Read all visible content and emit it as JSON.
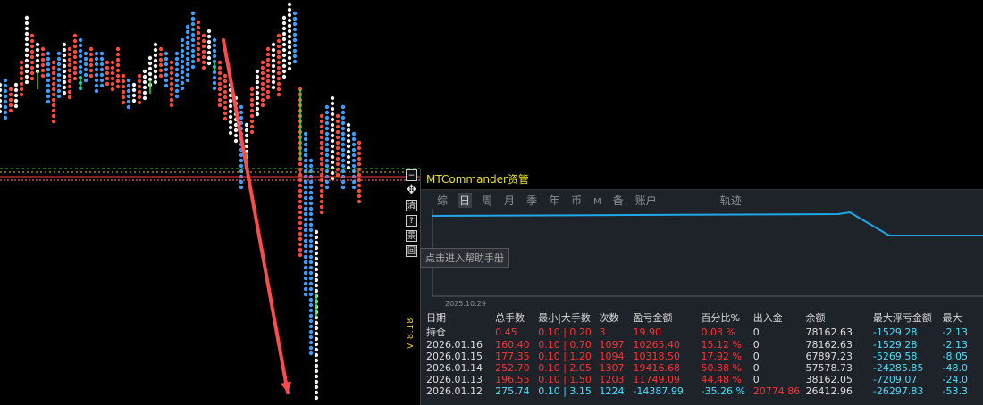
{
  "panel": {
    "title": "MTCommander资管",
    "version": "V 8.18",
    "help_tooltip": "点击进入帮助手册",
    "side_tools": [
      "清",
      "?",
      "景",
      "回"
    ],
    "tabs": [
      "综",
      "日",
      "周",
      "月",
      "季",
      "年",
      "币",
      "M",
      "备",
      "账户",
      "轨迹"
    ],
    "active_tab": "日",
    "curve_date": "2025.10.29",
    "columns": [
      "日期",
      "总手数",
      "最小|大手数",
      "次数",
      "盈亏金额",
      "百分比%",
      "出入金",
      "余额",
      "最大浮亏金额",
      "最大"
    ],
    "rows": [
      {
        "date": "持仓",
        "lots": "0.45",
        "minmax": "0.10 | 0.20",
        "count": "3",
        "pl": "19.90",
        "pct": "0.03 %",
        "io": "0",
        "balance": "78162.63",
        "float": "-1529.28",
        "last": "-2.13",
        "color": "red"
      },
      {
        "date": "2026.01.16",
        "lots": "160.40",
        "minmax": "0.10 | 0.70",
        "count": "1097",
        "pl": "10265.40",
        "pct": "15.12 %",
        "io": "0",
        "balance": "78162.63",
        "float": "-1529.28",
        "last": "-2.13",
        "color": "red"
      },
      {
        "date": "2026.01.15",
        "lots": "177.35",
        "minmax": "0.10 | 1.20",
        "count": "1094",
        "pl": "10318.50",
        "pct": "17.92 %",
        "io": "0",
        "balance": "67897.23",
        "float": "-5269.58",
        "last": "-8.05",
        "color": "red"
      },
      {
        "date": "2026.01.14",
        "lots": "252.70",
        "minmax": "0.10 | 2.05",
        "count": "1307",
        "pl": "19416.68",
        "pct": "50.88 %",
        "io": "0",
        "balance": "57578.73",
        "float": "-24285.85",
        "last": "-48.0",
        "color": "red"
      },
      {
        "date": "2026.01.13",
        "lots": "196.55",
        "minmax": "0.10 | 1.50",
        "count": "1203",
        "pl": "11749.09",
        "pct": "44.48 %",
        "io": "0",
        "balance": "38162.05",
        "float": "-7209.07",
        "last": "-24.0",
        "color": "red"
      },
      {
        "date": "2026.01.12",
        "lots": "275.74",
        "minmax": "0.10 | 3.15",
        "count": "1224",
        "pl": "-14387.99",
        "pct": "-35.26 %",
        "io": "20774.86",
        "balance": "26412.96",
        "float": "-26297.83",
        "last": "-53.3",
        "color": "cyan"
      }
    ]
  }
}
